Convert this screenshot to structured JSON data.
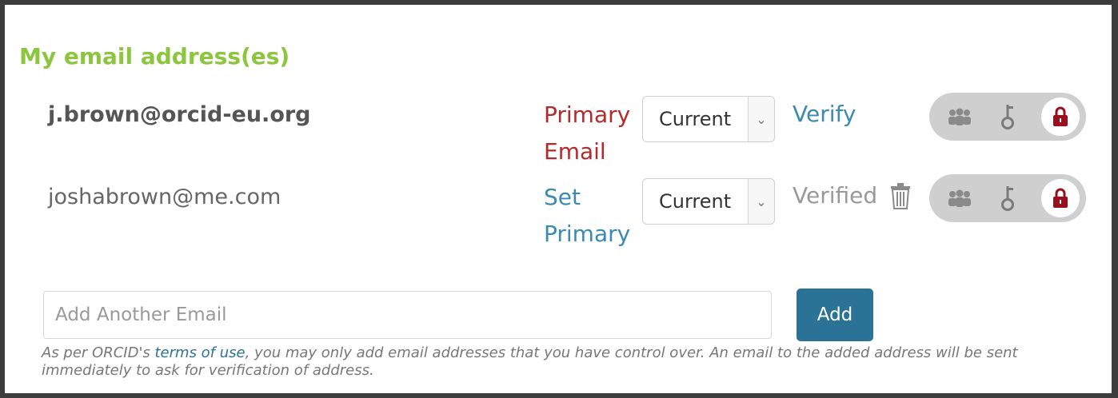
{
  "section": {
    "title": "My email address(es)"
  },
  "emails": [
    {
      "address": "j.brown@orcid-eu.org",
      "primary_label_line1": "Primary",
      "primary_label_line2": "Email",
      "status": "Current",
      "verify": "Verify"
    },
    {
      "address": "joshabrown@me.com",
      "primary_label_line1": "Set",
      "primary_label_line2": "Primary",
      "status": "Current",
      "verify": "Verified"
    }
  ],
  "add": {
    "placeholder": "Add Another Email",
    "button": "Add",
    "note_prefix": "As per ORCID's ",
    "note_link": "terms of use",
    "note_suffix": ", you may only add email addresses that you have control over. An email to the added address will be sent immediately to ask for verification of address."
  },
  "colors": {
    "title": "#8cc63f",
    "primary": "#b22a2a",
    "link": "#3b8ab0",
    "add_button": "#2a7296",
    "lock": "#9b0f1c"
  },
  "icons": [
    "trash-icon",
    "group-icon",
    "key-icon",
    "lock-icon",
    "chevron-down-icon"
  ]
}
